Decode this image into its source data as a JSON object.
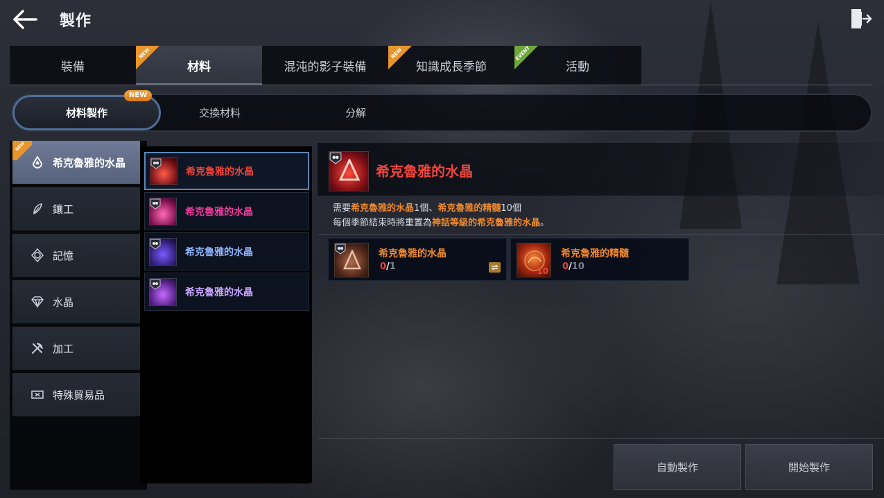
{
  "header": {
    "title": "製作"
  },
  "top_tabs": [
    {
      "label": "裝備",
      "badge": ""
    },
    {
      "label": "材料",
      "badge": "NEW"
    },
    {
      "label": "混沌的影子裝備",
      "badge": ""
    },
    {
      "label": "知識成長季節",
      "badge": "NEW"
    },
    {
      "label": "活動",
      "badge": "EVENT"
    }
  ],
  "sub_tabs": [
    {
      "label": "材料製作",
      "badge": "NEW"
    },
    {
      "label": "交換材料"
    },
    {
      "label": "分解"
    }
  ],
  "categories": [
    {
      "label": "希克魯雅的水晶",
      "icon": "crystal-drop-icon",
      "badge": "NEW"
    },
    {
      "label": "鑲工",
      "icon": "feather-icon"
    },
    {
      "label": "記憶",
      "icon": "memory-icon"
    },
    {
      "label": "水晶",
      "icon": "gem-icon"
    },
    {
      "label": "加工",
      "icon": "tools-icon"
    },
    {
      "label": "特殊貿易品",
      "icon": "ticket-icon"
    }
  ],
  "items": [
    {
      "name": "希克魯雅的水晶",
      "color": "#f0443a",
      "gem": "#c8262a"
    },
    {
      "name": "希克魯雅的水晶",
      "color": "#f03a9e",
      "gem": "#c01a78"
    },
    {
      "name": "希克魯雅的水晶",
      "color": "#8fb6ff",
      "gem": "#5a3ab8"
    },
    {
      "name": "希克魯雅的水晶",
      "color": "#c9a8ff",
      "gem": "#8a3ad0"
    }
  ],
  "detail": {
    "title": "希克魯雅的水晶",
    "line1_prefix": "需要",
    "line1_item1": "希克魯雅的水晶",
    "line1_qty1": "1個、",
    "line1_item2": "希克魯雅的精髓",
    "line1_qty2": "10個",
    "line2_prefix": "每個季節結束時將重置為",
    "line2_highlight": "神話等級的希克魯雅的水晶",
    "line2_suffix": "。"
  },
  "materials": [
    {
      "name": "希克魯雅的水晶",
      "have": "0",
      "need": "1",
      "swap": true
    },
    {
      "name": "希克魯雅的精髓",
      "have": "0",
      "need": "10",
      "stack": "10"
    }
  ],
  "buttons": {
    "auto_craft": "自動製作",
    "start_craft": "開始製作"
  },
  "colors": {
    "accent_orange": "#f08a2c",
    "title_red": "#f0443a",
    "selected_border": "#5a86b8"
  }
}
